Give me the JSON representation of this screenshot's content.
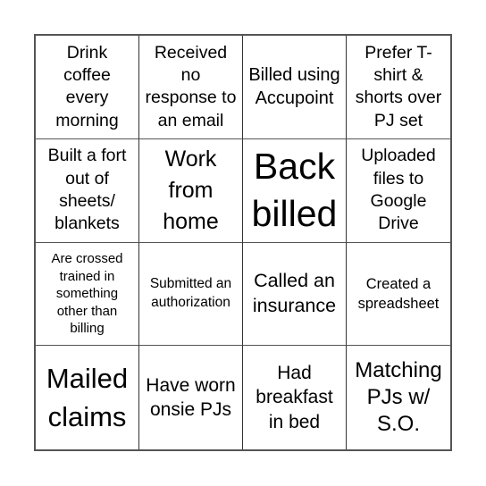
{
  "board": {
    "rows": [
      [
        {
          "text": "Drink coffee every morning"
        },
        {
          "text": "Received no response to an email"
        },
        {
          "text": "Billed using Accupoint"
        },
        {
          "text": "Prefer T-shirt & shorts over PJ set"
        }
      ],
      [
        {
          "text": "Built a fort out of sheets/ blankets"
        },
        {
          "text": "Work from home"
        },
        {
          "text": "Back billed"
        },
        {
          "text": "Uploaded files to Google Drive"
        }
      ],
      [
        {
          "text": "Are crossed trained in something other than billing"
        },
        {
          "text": "Submitted an authorization"
        },
        {
          "text": "Called an insurance"
        },
        {
          "text": "Created a spreadsheet"
        }
      ],
      [
        {
          "text": "Mailed claims"
        },
        {
          "text": "Have worn onsie PJs"
        },
        {
          "text": "Had breakfast in bed"
        },
        {
          "text": "Matching PJs w/ S.O."
        }
      ]
    ]
  }
}
